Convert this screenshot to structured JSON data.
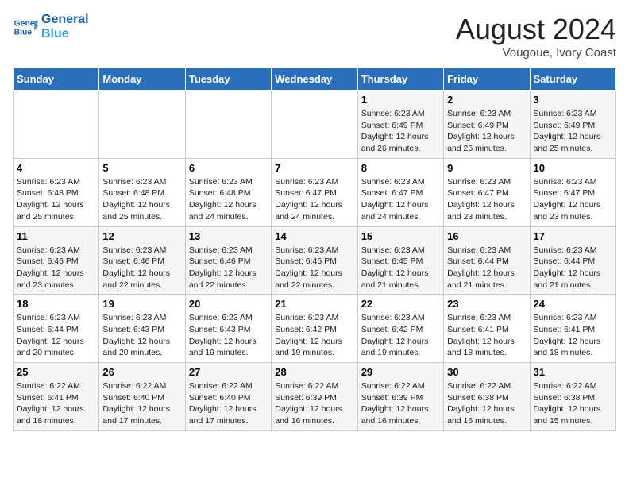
{
  "header": {
    "logo_line1": "General",
    "logo_line2": "Blue",
    "title": "August 2024",
    "subtitle": "Vougoue, Ivory Coast"
  },
  "weekdays": [
    "Sunday",
    "Monday",
    "Tuesday",
    "Wednesday",
    "Thursday",
    "Friday",
    "Saturday"
  ],
  "weeks": [
    [
      {
        "day": "",
        "info": ""
      },
      {
        "day": "",
        "info": ""
      },
      {
        "day": "",
        "info": ""
      },
      {
        "day": "",
        "info": ""
      },
      {
        "day": "1",
        "info": "Sunrise: 6:23 AM\nSunset: 6:49 PM\nDaylight: 12 hours and 26 minutes."
      },
      {
        "day": "2",
        "info": "Sunrise: 6:23 AM\nSunset: 6:49 PM\nDaylight: 12 hours and 26 minutes."
      },
      {
        "day": "3",
        "info": "Sunrise: 6:23 AM\nSunset: 6:49 PM\nDaylight: 12 hours and 25 minutes."
      }
    ],
    [
      {
        "day": "4",
        "info": "Sunrise: 6:23 AM\nSunset: 6:48 PM\nDaylight: 12 hours and 25 minutes."
      },
      {
        "day": "5",
        "info": "Sunrise: 6:23 AM\nSunset: 6:48 PM\nDaylight: 12 hours and 25 minutes."
      },
      {
        "day": "6",
        "info": "Sunrise: 6:23 AM\nSunset: 6:48 PM\nDaylight: 12 hours and 24 minutes."
      },
      {
        "day": "7",
        "info": "Sunrise: 6:23 AM\nSunset: 6:47 PM\nDaylight: 12 hours and 24 minutes."
      },
      {
        "day": "8",
        "info": "Sunrise: 6:23 AM\nSunset: 6:47 PM\nDaylight: 12 hours and 24 minutes."
      },
      {
        "day": "9",
        "info": "Sunrise: 6:23 AM\nSunset: 6:47 PM\nDaylight: 12 hours and 23 minutes."
      },
      {
        "day": "10",
        "info": "Sunrise: 6:23 AM\nSunset: 6:47 PM\nDaylight: 12 hours and 23 minutes."
      }
    ],
    [
      {
        "day": "11",
        "info": "Sunrise: 6:23 AM\nSunset: 6:46 PM\nDaylight: 12 hours and 23 minutes."
      },
      {
        "day": "12",
        "info": "Sunrise: 6:23 AM\nSunset: 6:46 PM\nDaylight: 12 hours and 22 minutes."
      },
      {
        "day": "13",
        "info": "Sunrise: 6:23 AM\nSunset: 6:46 PM\nDaylight: 12 hours and 22 minutes."
      },
      {
        "day": "14",
        "info": "Sunrise: 6:23 AM\nSunset: 6:45 PM\nDaylight: 12 hours and 22 minutes."
      },
      {
        "day": "15",
        "info": "Sunrise: 6:23 AM\nSunset: 6:45 PM\nDaylight: 12 hours and 21 minutes."
      },
      {
        "day": "16",
        "info": "Sunrise: 6:23 AM\nSunset: 6:44 PM\nDaylight: 12 hours and 21 minutes."
      },
      {
        "day": "17",
        "info": "Sunrise: 6:23 AM\nSunset: 6:44 PM\nDaylight: 12 hours and 21 minutes."
      }
    ],
    [
      {
        "day": "18",
        "info": "Sunrise: 6:23 AM\nSunset: 6:44 PM\nDaylight: 12 hours and 20 minutes."
      },
      {
        "day": "19",
        "info": "Sunrise: 6:23 AM\nSunset: 6:43 PM\nDaylight: 12 hours and 20 minutes."
      },
      {
        "day": "20",
        "info": "Sunrise: 6:23 AM\nSunset: 6:43 PM\nDaylight: 12 hours and 19 minutes."
      },
      {
        "day": "21",
        "info": "Sunrise: 6:23 AM\nSunset: 6:42 PM\nDaylight: 12 hours and 19 minutes."
      },
      {
        "day": "22",
        "info": "Sunrise: 6:23 AM\nSunset: 6:42 PM\nDaylight: 12 hours and 19 minutes."
      },
      {
        "day": "23",
        "info": "Sunrise: 6:23 AM\nSunset: 6:41 PM\nDaylight: 12 hours and 18 minutes."
      },
      {
        "day": "24",
        "info": "Sunrise: 6:23 AM\nSunset: 6:41 PM\nDaylight: 12 hours and 18 minutes."
      }
    ],
    [
      {
        "day": "25",
        "info": "Sunrise: 6:22 AM\nSunset: 6:41 PM\nDaylight: 12 hours and 18 minutes."
      },
      {
        "day": "26",
        "info": "Sunrise: 6:22 AM\nSunset: 6:40 PM\nDaylight: 12 hours and 17 minutes."
      },
      {
        "day": "27",
        "info": "Sunrise: 6:22 AM\nSunset: 6:40 PM\nDaylight: 12 hours and 17 minutes."
      },
      {
        "day": "28",
        "info": "Sunrise: 6:22 AM\nSunset: 6:39 PM\nDaylight: 12 hours and 16 minutes."
      },
      {
        "day": "29",
        "info": "Sunrise: 6:22 AM\nSunset: 6:39 PM\nDaylight: 12 hours and 16 minutes."
      },
      {
        "day": "30",
        "info": "Sunrise: 6:22 AM\nSunset: 6:38 PM\nDaylight: 12 hours and 16 minutes."
      },
      {
        "day": "31",
        "info": "Sunrise: 6:22 AM\nSunset: 6:38 PM\nDaylight: 12 hours and 15 minutes."
      }
    ]
  ]
}
